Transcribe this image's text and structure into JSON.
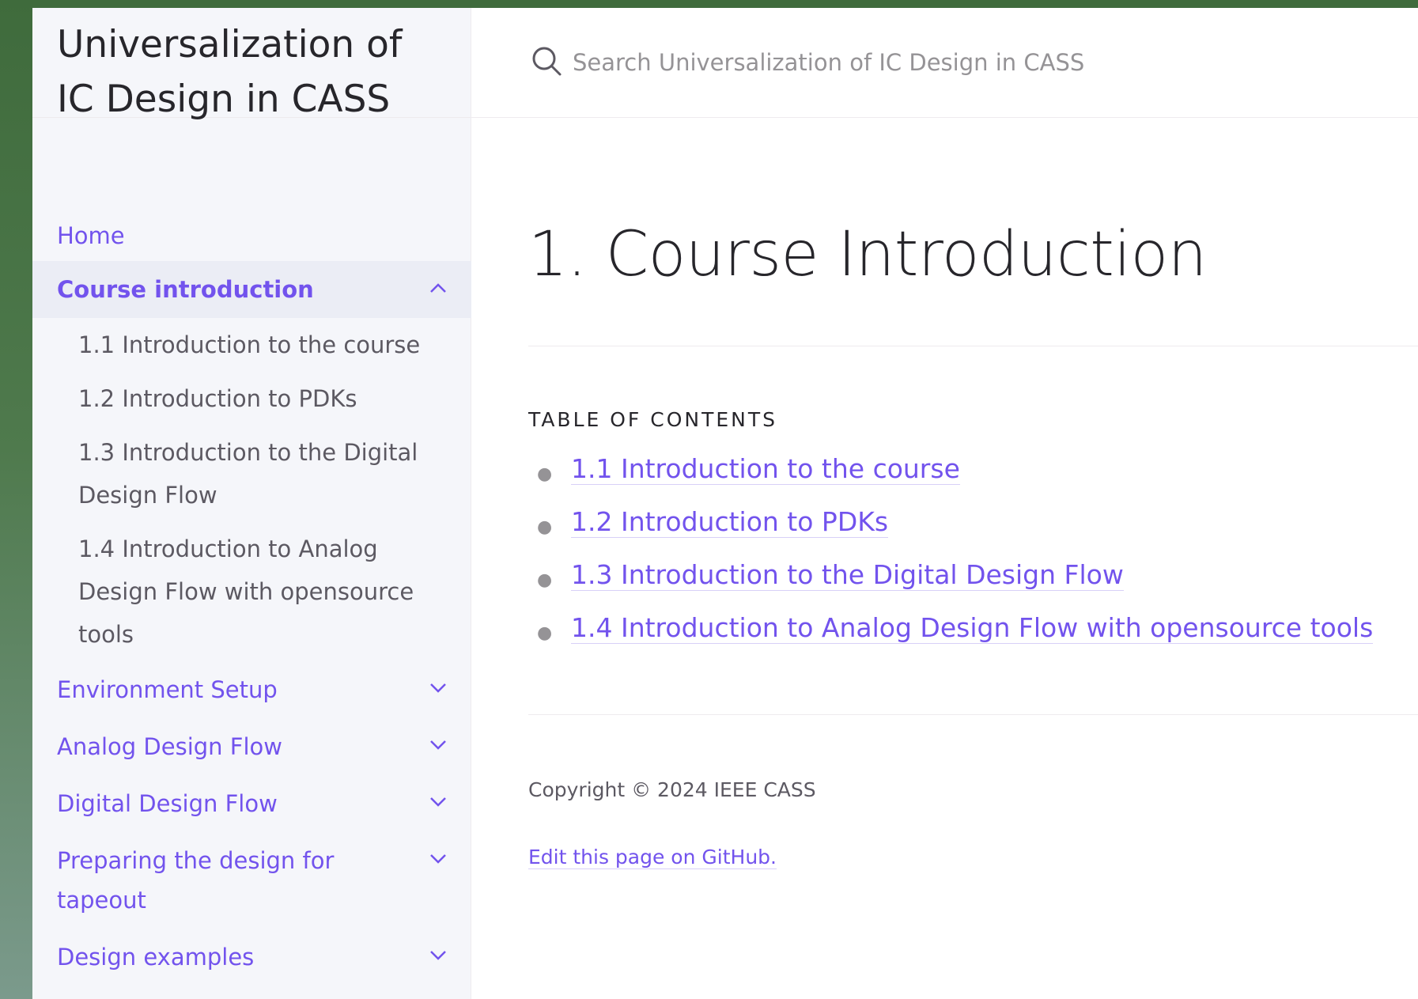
{
  "site": {
    "title": "Universalization of IC Design in CASS"
  },
  "search": {
    "placeholder": "Search Universalization of IC Design in CASS"
  },
  "sidebar": {
    "items": [
      {
        "label": "Home"
      },
      {
        "label": "Course introduction",
        "expanded": true,
        "children": [
          {
            "label": "1.1 Introduction to the course"
          },
          {
            "label": "1.2 Introduction to PDKs"
          },
          {
            "label": "1.3 Introduction to the Digital Design Flow"
          },
          {
            "label": "1.4 Introduction to Analog Design Flow with opensource tools"
          }
        ]
      },
      {
        "label": "Environment Setup"
      },
      {
        "label": "Analog Design Flow"
      },
      {
        "label": "Digital Design Flow"
      },
      {
        "label": "Preparing the design for tapeout"
      },
      {
        "label": "Design examples"
      }
    ]
  },
  "main": {
    "title": "1. Course Introduction",
    "toc_label": "Table of contents",
    "toc": [
      "1.1 Introduction to the course",
      "1.2 Introduction to PDKs",
      "1.3 Introduction to the Digital Design Flow",
      "1.4 Introduction to Analog Design Flow with opensource tools"
    ],
    "footer": {
      "copyright": "Copyright © 2024 IEEE CASS",
      "edit_link": "Edit this page on GitHub."
    }
  },
  "colors": {
    "accent": "#7253ed",
    "text": "#27262b",
    "muted": "#5c5962",
    "sidebar_bg": "#f5f6fa"
  },
  "icons": {
    "search": "search-icon",
    "expanded": "chevron-up-icon",
    "collapsed": "chevron-down-icon"
  }
}
